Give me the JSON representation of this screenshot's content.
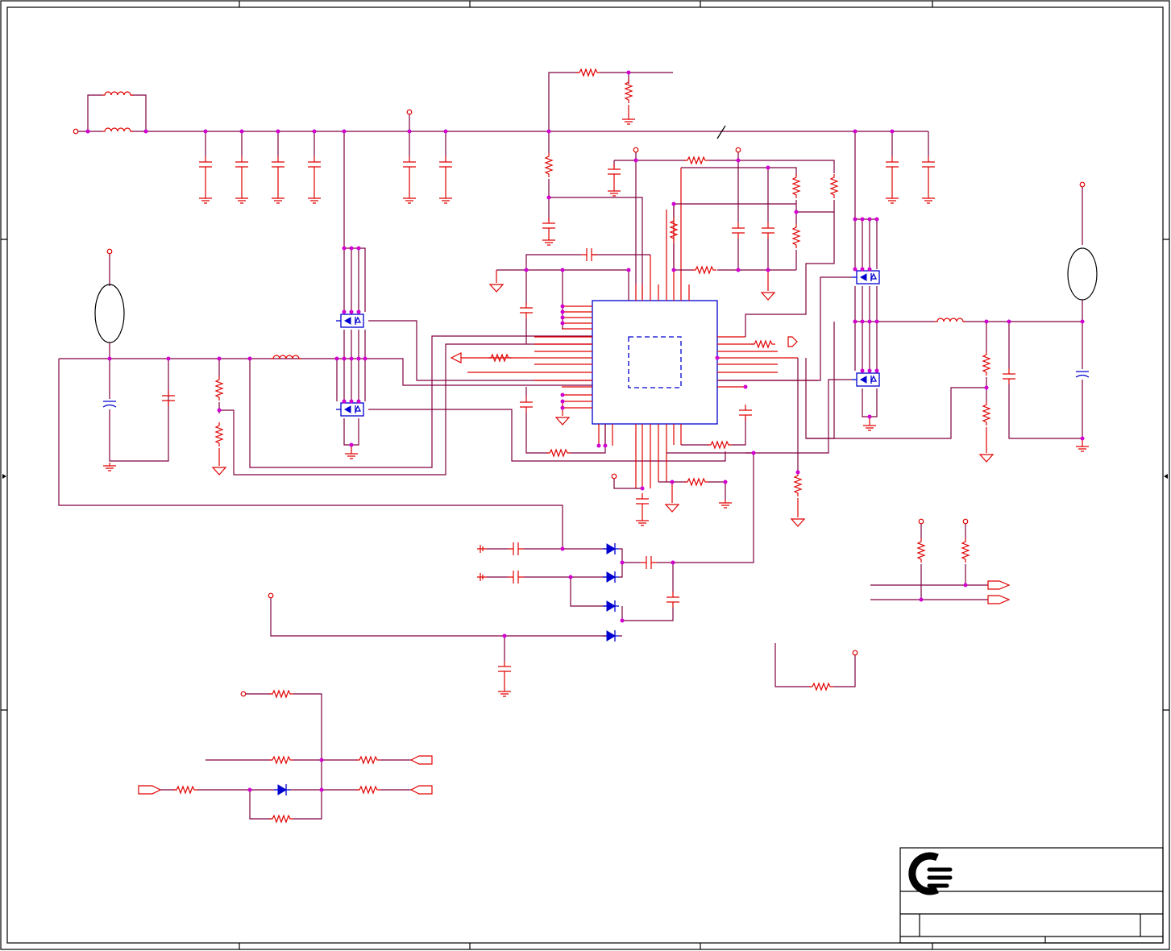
{
  "title_block": {
    "logo": "company-logo",
    "title": "",
    "sheet": "",
    "rev": ""
  },
  "colors": {
    "wire": "#800040",
    "component": "#e00000",
    "active_device": "#0000d0",
    "junction": "#d000d0",
    "frame": "#000000"
  }
}
